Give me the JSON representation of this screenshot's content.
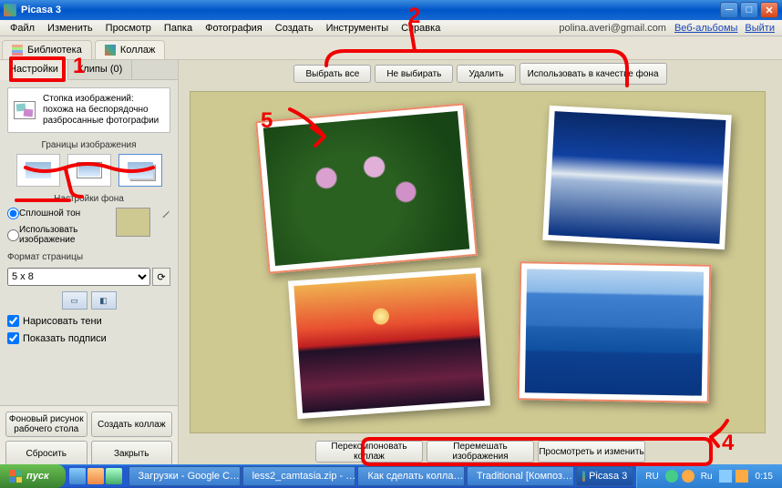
{
  "title": "Picasa 3",
  "menu": [
    "Файл",
    "Изменить",
    "Просмотр",
    "Папка",
    "Фотография",
    "Создать",
    "Инструменты",
    "Справка"
  ],
  "account_email": "polina.averi@gmail.com",
  "account_links": [
    "Веб-альбомы",
    "Выйти"
  ],
  "tabs": {
    "library": "Библиотека",
    "collage": "Коллаж"
  },
  "side_tabs": {
    "settings": "Настройки",
    "clips": "Клипы (0)"
  },
  "layout_desc": "Стопка изображений: похожа на беспорядочно разбросанные фотографии",
  "sections": {
    "borders": "Границы изображения",
    "background": "Настройки фона",
    "page_format": "Формат страницы"
  },
  "bg": {
    "solid": "Сплошной тон",
    "use_image": "Использовать изображение"
  },
  "page_format_value": "5 x 8",
  "checks": {
    "shadows": "Нарисовать тени",
    "captions": "Показать подписи"
  },
  "side_buttons": {
    "wallpaper": "Фоновый рисунок рабочего стола",
    "create": "Создать коллаж",
    "reset": "Сбросить",
    "close": "Закрыть"
  },
  "top_buttons": {
    "select_all": "Выбрать все",
    "select_none": "Не выбирать",
    "delete": "Удалить",
    "use_as_bg": "Использовать в качестве фона"
  },
  "bottom_buttons": {
    "recompose": "Перекомпоновать коллаж",
    "shuffle": "Перемешать изображения",
    "preview": "Просмотреть и изменить"
  },
  "taskbar": {
    "start": "пуск",
    "items": [
      "Загрузки - Google C…",
      "less2_camtasia.zip - …",
      "Как сделать колла…",
      "Traditional [Композ…",
      "Picasa 3"
    ],
    "lang": "RU",
    "clock": "0:15"
  },
  "annot": {
    "n1": "1",
    "n2": "2",
    "n4": "4",
    "n5": "5"
  }
}
